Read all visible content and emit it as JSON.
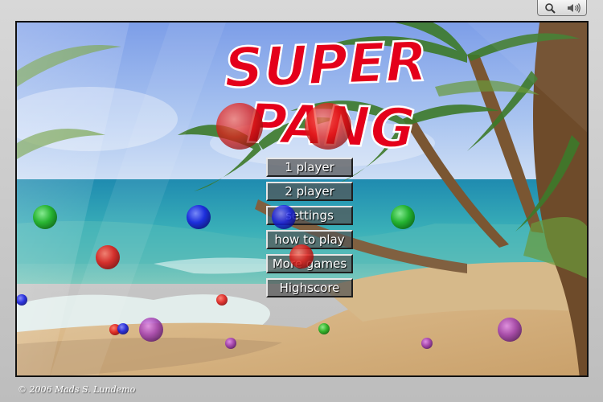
{
  "title": {
    "line1": "SUPER",
    "line2": "PANG"
  },
  "menu": [
    {
      "id": "one-player",
      "label": "1 player"
    },
    {
      "id": "two-player",
      "label": "2 player"
    },
    {
      "id": "settings",
      "label": "settings"
    },
    {
      "id": "how-to-play",
      "label": "how to play"
    },
    {
      "id": "more-games",
      "label": "More games"
    },
    {
      "id": "highscore",
      "label": "Highscore"
    }
  ],
  "toolbar": {
    "icons": [
      "magnifier-icon",
      "speaker-icon"
    ]
  },
  "footer": {
    "copyright": "© 2006 Mads S. Lundemo"
  },
  "colors": {
    "title_fill": "#e4001a",
    "title_outline": "#ffffff",
    "ball_red": "#e0201c",
    "ball_green": "#22b422",
    "ball_blue": "#1a22e0",
    "ball_purple": "#a03cb0"
  }
}
